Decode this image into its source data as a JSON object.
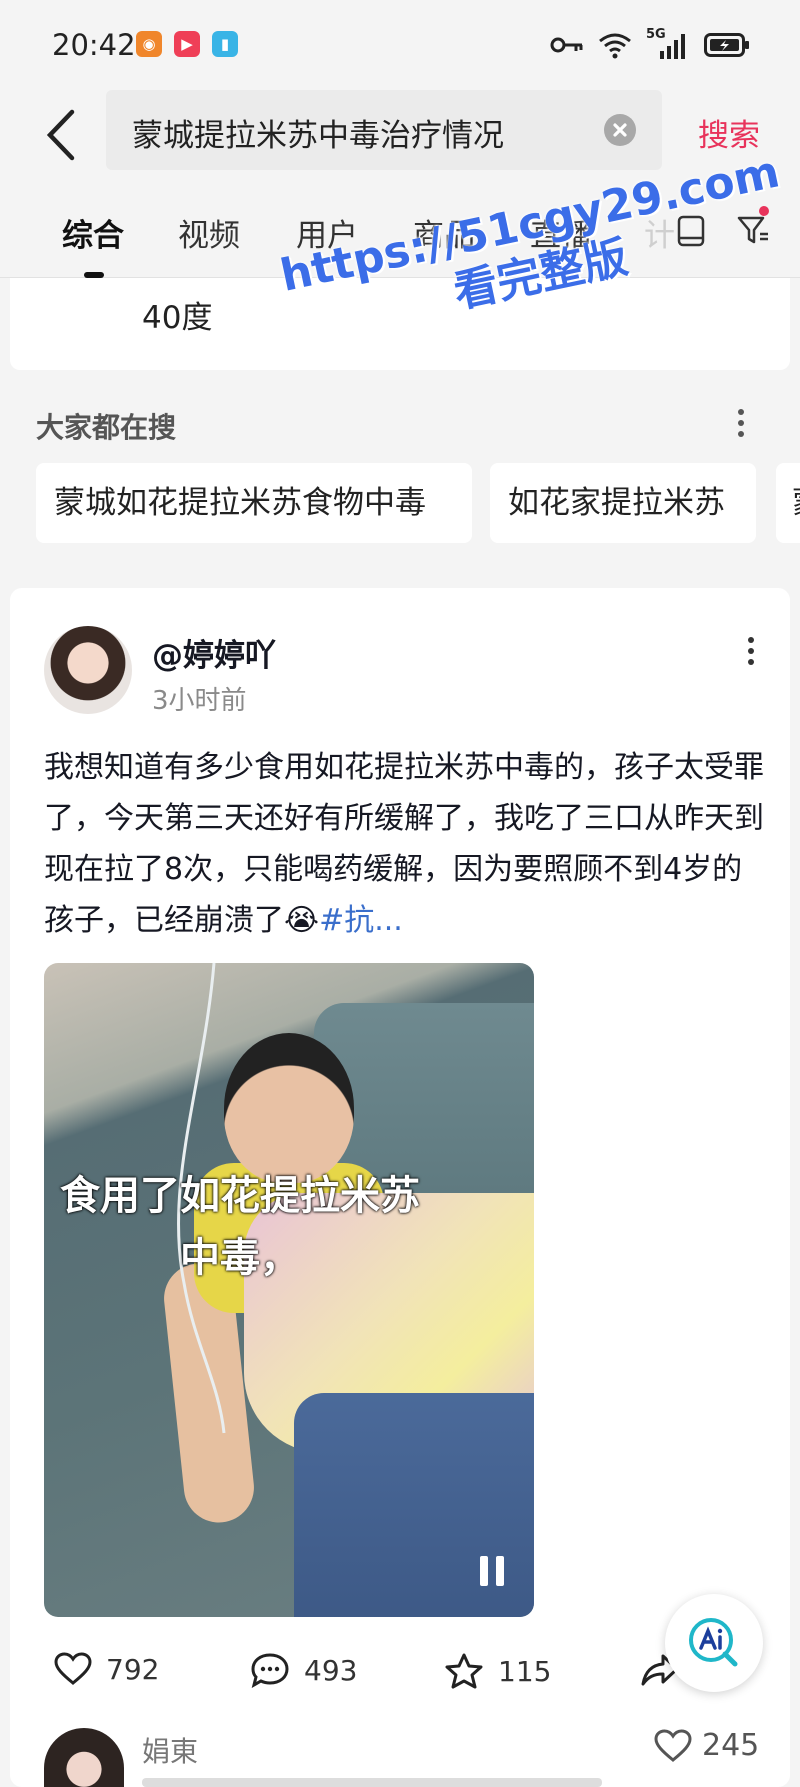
{
  "status_bar": {
    "time": "20:42",
    "network": "5G",
    "app_icons": [
      "taobao-icon",
      "video-app-icon",
      "reader-app-icon"
    ],
    "icons": [
      "key-icon",
      "wifi-icon",
      "signal-icon",
      "battery-icon"
    ]
  },
  "search": {
    "query": "蒙城提拉米苏中毒治疗情况",
    "submit_label": "搜索"
  },
  "tabs": [
    {
      "label": "综合",
      "active": true
    },
    {
      "label": "视频",
      "active": false
    },
    {
      "label": "用户",
      "active": false
    },
    {
      "label": "商品",
      "active": false
    },
    {
      "label": "直播",
      "active": false
    },
    {
      "label": "计",
      "active": false
    }
  ],
  "previous_card": {
    "text": "40度"
  },
  "suggestions": {
    "title": "大家都在搜",
    "chips": [
      "蒙城如花提拉米苏食物中毒",
      "如花家提拉米苏",
      "蒙"
    ]
  },
  "watermark": {
    "line1": "https://51cgy29.com",
    "line2": "看完整版"
  },
  "post": {
    "author": "@婷婷吖",
    "time": "3小时前",
    "body": "我想知道有多少食用如花提拉米苏中毒的，孩子太受罪了，今天第三天还好有所缓解了，我吃了三口从昨天到现在拉了8次，只能喝药缓解，因为要照顾不到4岁的孩子，已经崩溃了😭",
    "tag": "#抗...",
    "video_caption_line1": "食用了如花提拉米苏",
    "video_caption_line2": "中毒，",
    "likes": "792",
    "comments": "493",
    "favorites": "115"
  },
  "comment": {
    "author": "娟東",
    "likes": "245"
  },
  "colors": {
    "accent": "#e8335b",
    "link": "#3a6ecb",
    "watermark": "#3b6de8",
    "background": "#f4f4f4"
  }
}
